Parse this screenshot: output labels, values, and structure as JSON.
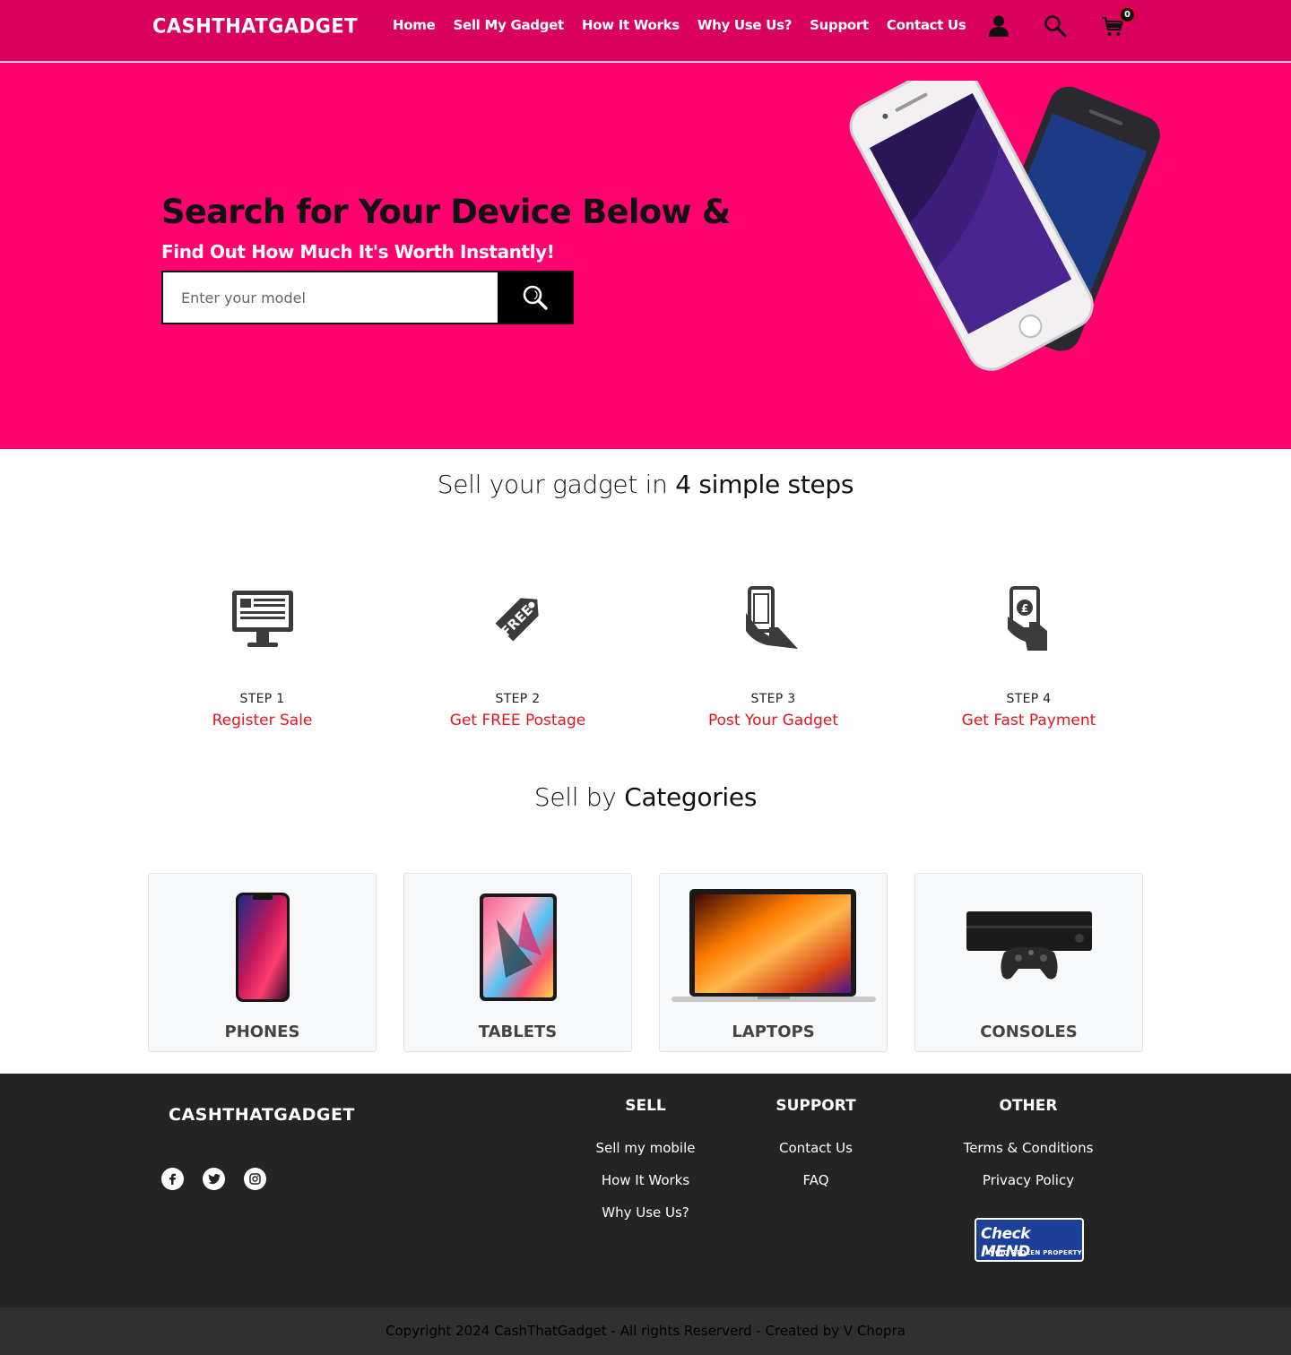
{
  "brand": {
    "logo": "CASHTHATGADGET",
    "accent": "#ff0270",
    "header_bg": "#d9005e"
  },
  "nav": {
    "items": [
      "Home",
      "Sell My Gadget",
      "How It Works",
      "Why Use Us?",
      "Support",
      "Contact Us"
    ]
  },
  "header_icons": {
    "account": "user-icon",
    "search": "search-icon",
    "cart": "cart-icon",
    "cart_count": "0"
  },
  "hero": {
    "title": "Search for Your Device Below &",
    "subtitle": "Find Out How Much It's Worth Instantly!",
    "search_placeholder": "Enter your model"
  },
  "steps_section": {
    "title_light_1": "Sell your gadget",
    "title_light_2": "in",
    "title_bold": "4 simple steps",
    "steps": [
      {
        "num": "STEP 1",
        "label": "Register Sale",
        "icon": "monitor-icon"
      },
      {
        "num": "STEP 2",
        "label": "Get FREE Postage",
        "icon": "free-tag-icon"
      },
      {
        "num": "STEP 3",
        "label": "Post Your Gadget",
        "icon": "hand-phone-icon"
      },
      {
        "num": "STEP 4",
        "label": "Get Fast Payment",
        "icon": "hand-payment-icon"
      }
    ]
  },
  "categories_section": {
    "title_light": "Sell by",
    "title_bold": "Categories",
    "items": [
      {
        "label": "PHONES"
      },
      {
        "label": "TABLETS"
      },
      {
        "label": "LAPTOPS"
      },
      {
        "label": "CONSOLES"
      }
    ]
  },
  "footer": {
    "logo": "CASHTHATGADGET",
    "social": [
      "facebook-icon",
      "twitter-icon",
      "instagram-icon"
    ],
    "sell": {
      "heading": "SELL",
      "links": [
        "Sell my mobile",
        "How It Works",
        "Why Use Us?"
      ]
    },
    "support": {
      "heading": "SUPPORT",
      "links": [
        "Contact Us",
        "FAQ"
      ]
    },
    "other": {
      "heading": "OTHER",
      "links": [
        "Terms & Conditions",
        "Privacy Policy"
      ]
    },
    "checkmend": {
      "main": "Check MEND",
      "sub": "AVOID STOLEN PROPERTY"
    },
    "copyright": "Copyright 2024 CashThatGadget - All rights Reserverd - Created by V Chopra"
  }
}
